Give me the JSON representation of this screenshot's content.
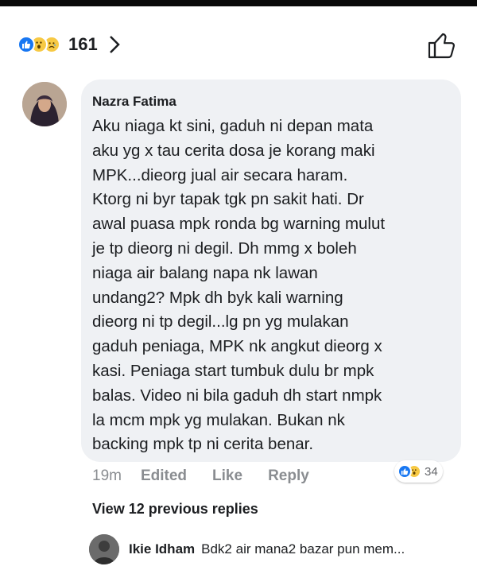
{
  "reactions": {
    "count": "161",
    "types": [
      "like-icon",
      "wow-icon",
      "sad-icon"
    ],
    "like_color": "#1877f2",
    "emoji_color": "#f7c944"
  },
  "comment": {
    "author": "Nazra Fatima",
    "text": "Aku niaga kt sini, gaduh ni depan mata\naku yg x tau cerita dosa je korang maki\nMPK...dieorg jual air secara haram.\nKtorg ni byr tapak tgk pn sakit hati. Dr\nawal puasa mpk ronda bg warning mulut\nje tp dieorg ni degil. Dh mmg x boleh\nniaga air balang napa nk lawan\nundang2?   Mpk dh byk kali warning\ndieorg ni tp degil...lg pn yg mulakan\ngaduh peniaga, MPK nk angkut dieorg x\nkasi. Peniaga start tumbuk dulu br mpk\nbalas. Video ni bila gaduh dh start nmpk\nla mcm mpk yg mulakan. Bukan nk\nbacking mpk tp ni cerita benar.",
    "time": "19m",
    "actions": {
      "edited": "Edited",
      "like": "Like",
      "reply": "Reply"
    },
    "reaction_count": "34",
    "bubble_color": "#eff1f4"
  },
  "view_replies": "View 12 previous replies",
  "reply": {
    "author": "Ikie Idham",
    "snippet": "Bdk2 air mana2 bazar pun mem..."
  }
}
